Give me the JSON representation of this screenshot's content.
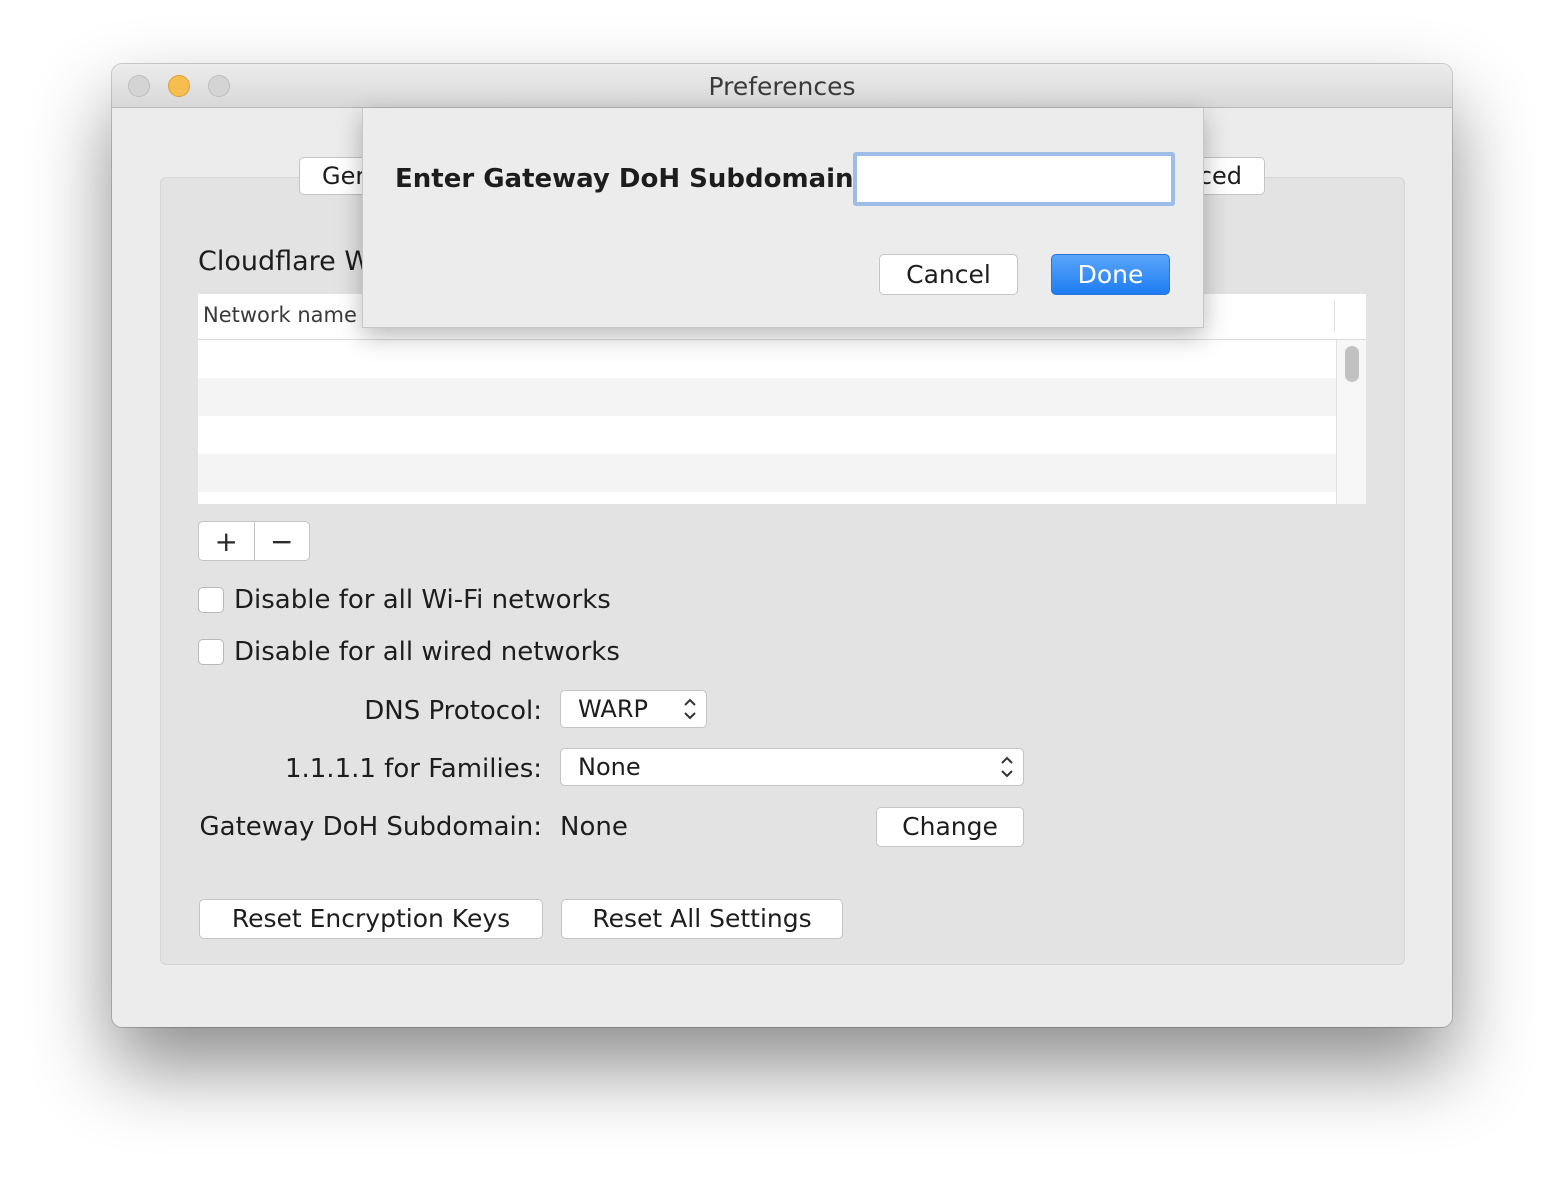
{
  "window": {
    "title": "Preferences"
  },
  "tabs": [
    {
      "label": "Ger"
    },
    {
      "label": "ced"
    }
  ],
  "section": {
    "title": "Cloudflare W"
  },
  "table": {
    "columns": [
      "Network name"
    ],
    "rows": []
  },
  "segmented": {
    "add_symbol": "+",
    "remove_symbol": "−"
  },
  "checkboxes": {
    "wifi_label": "Disable for all Wi-Fi networks",
    "wifi_checked": false,
    "wired_label": "Disable for all wired networks",
    "wired_checked": false
  },
  "form": {
    "dns_protocol_label": "DNS Protocol:",
    "dns_protocol_value": "WARP",
    "families_label": "1.1.1.1 for Families:",
    "families_value": "None",
    "gateway_label": "Gateway DoH Subdomain:",
    "gateway_value": "None",
    "change_button": "Change"
  },
  "actions": {
    "reset_keys": "Reset Encryption Keys",
    "reset_all": "Reset All Settings"
  },
  "sheet": {
    "label": "Enter Gateway DoH Subdomain:",
    "input_value": "",
    "cancel": "Cancel",
    "done": "Done"
  },
  "colors": {
    "accent": "#1d7cf2",
    "focus_ring": "#9dbde9",
    "minimize_light": "#f5be4f"
  }
}
